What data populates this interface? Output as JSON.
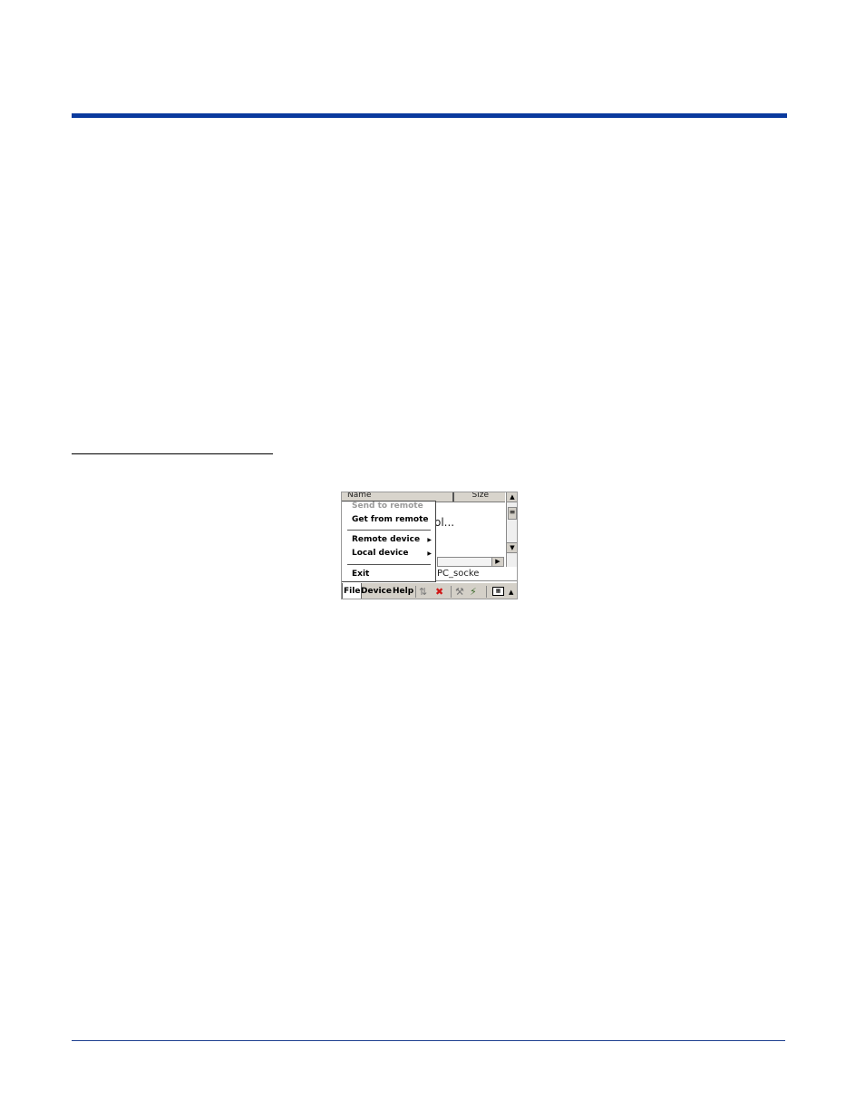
{
  "menu": {
    "items": [
      {
        "label": "Send to remote",
        "enabled": false
      },
      {
        "label": "Get from remote",
        "enabled": true
      },
      {
        "label": "Remote device",
        "submenu": true
      },
      {
        "label": "Local device",
        "submenu": true
      },
      {
        "label": "Exit",
        "enabled": true
      }
    ]
  },
  "list": {
    "col_name": "Name",
    "col_size": "Size",
    "item_fragment": "ol...",
    "status_fragment": "PC_socke"
  },
  "menubar": {
    "file": "File",
    "device": "Device",
    "help": "Help"
  },
  "icons": {
    "transfer": "transfer-icon",
    "disconnect": "disconnect-icon",
    "tool1": "tool-icon",
    "tool2": "tool-connect-icon",
    "keyboard": "keyboard-icon",
    "sip_up": "up-arrow-icon"
  },
  "colors": {
    "header_rule": "#0a3a9e",
    "footer_rule": "#1e3f8f",
    "disconnect_icon": "#d01818"
  }
}
